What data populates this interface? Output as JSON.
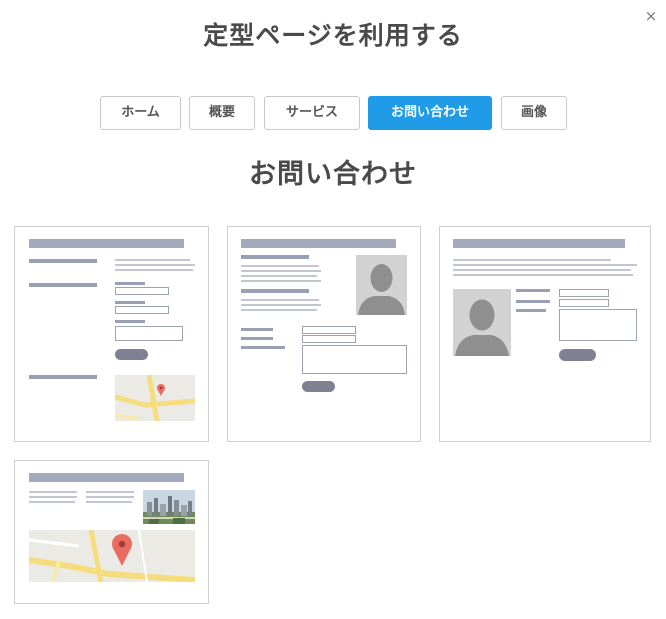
{
  "dialog": {
    "title": "定型ページを利用する",
    "close_glyph": "×"
  },
  "tabs": [
    {
      "label": "ホーム",
      "active": false
    },
    {
      "label": "概要",
      "active": false
    },
    {
      "label": "サービス",
      "active": false
    },
    {
      "label": "お問い合わせ",
      "active": true
    },
    {
      "label": "画像",
      "active": false
    }
  ],
  "section": {
    "title": "お問い合わせ"
  },
  "templates": [
    {
      "id": "contact-form-with-map"
    },
    {
      "id": "contact-with-portrait"
    },
    {
      "id": "contact-portrait-left"
    },
    {
      "id": "contact-photo-and-map"
    }
  ],
  "colors": {
    "accent": "#1f9be8",
    "header_bar": "#a4a9bb",
    "text_line": "#c3c6d2",
    "button": "#7e8191",
    "map_road": "#f5dd7e",
    "map_pin": "#e96c61"
  }
}
